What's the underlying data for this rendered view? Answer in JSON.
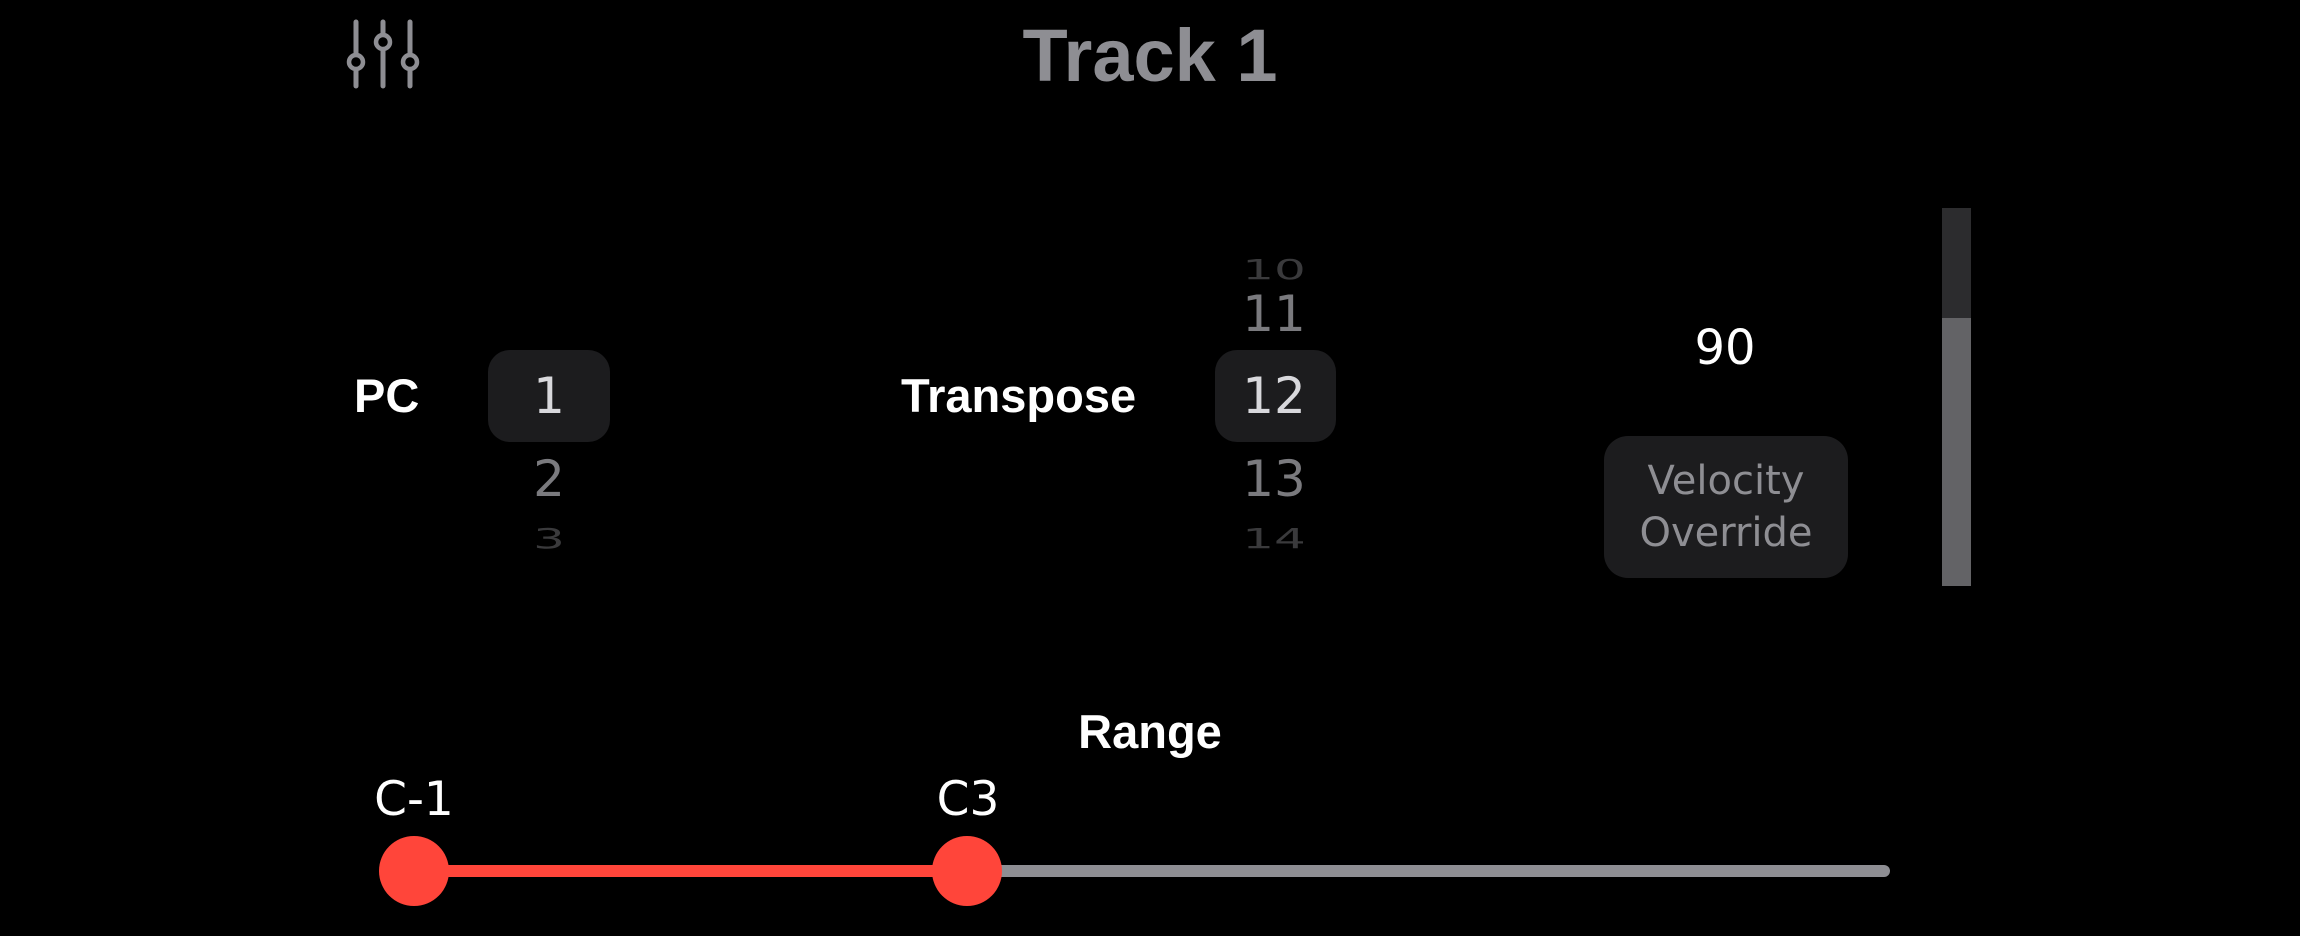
{
  "header": {
    "title": "Track 1",
    "mixer_icon": "sliders-icon"
  },
  "pc": {
    "label": "PC",
    "visible_values": [
      "1",
      "2",
      "3"
    ],
    "selected": "1"
  },
  "transpose": {
    "label": "Transpose",
    "visible_values": [
      "10",
      "11",
      "12",
      "13",
      "14"
    ],
    "selected": "12"
  },
  "velocity": {
    "value": "90",
    "button_label": "Velocity Override",
    "level_fraction": 0.71
  },
  "range": {
    "label": "Range",
    "low": "C-1",
    "high": "C3"
  },
  "colors": {
    "background": "#000000",
    "accent": "#ff453a",
    "title_gray": "#8e8e93",
    "control_bg": "#1c1c1e"
  }
}
